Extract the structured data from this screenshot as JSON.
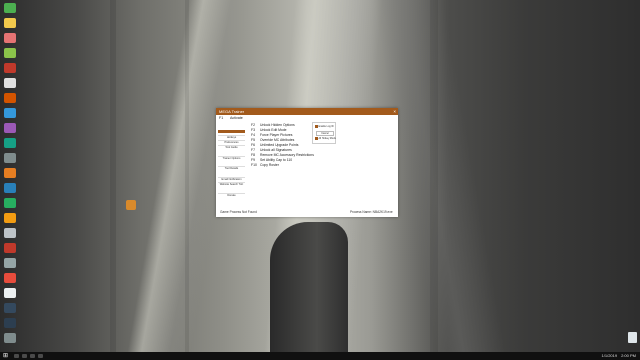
{
  "window": {
    "title": "MEGA Trainer",
    "close_glyph": "×",
    "activate_key": "F1",
    "activate_label": "Activate"
  },
  "sidebar": {
    "items": [
      "Hotkeys",
      "Preferences",
      "Tool Guide",
      "Trainer Options",
      "Tool Details",
      "Email Notification",
      "Website Search ToC",
      "Donate"
    ]
  },
  "hotkeys": [
    {
      "key": "F2",
      "label": "Unlock Hidden Options"
    },
    {
      "key": "F3",
      "label": "Unlock Edit Mode"
    },
    {
      "key": "F4",
      "label": "Force Player Pictures"
    },
    {
      "key": "F5",
      "label": "Override MC Attributes"
    },
    {
      "key": "F6",
      "label": "Unlimited Upgrade Points"
    },
    {
      "key": "F7",
      "label": "Unlock all Signatures"
    },
    {
      "key": "F8",
      "label": "Remove MC Accessory Restrictions"
    },
    {
      "key": "F9",
      "label": "Set Ability Cap to 110"
    },
    {
      "key": "F10",
      "label": "Copy Roster"
    }
  ],
  "options_panel": {
    "check1": "Enable Log ID",
    "button": "Cancel",
    "check2": "All Hotkey Mods"
  },
  "status": {
    "left": "Game Process Not Found",
    "right": "Process Name: NBA2K19.exe"
  },
  "taskbar": {
    "start_glyph": "⊞",
    "time": "2:00 PM",
    "date": "1/1/2019"
  },
  "colors": {
    "accent": "#a25a1c"
  }
}
